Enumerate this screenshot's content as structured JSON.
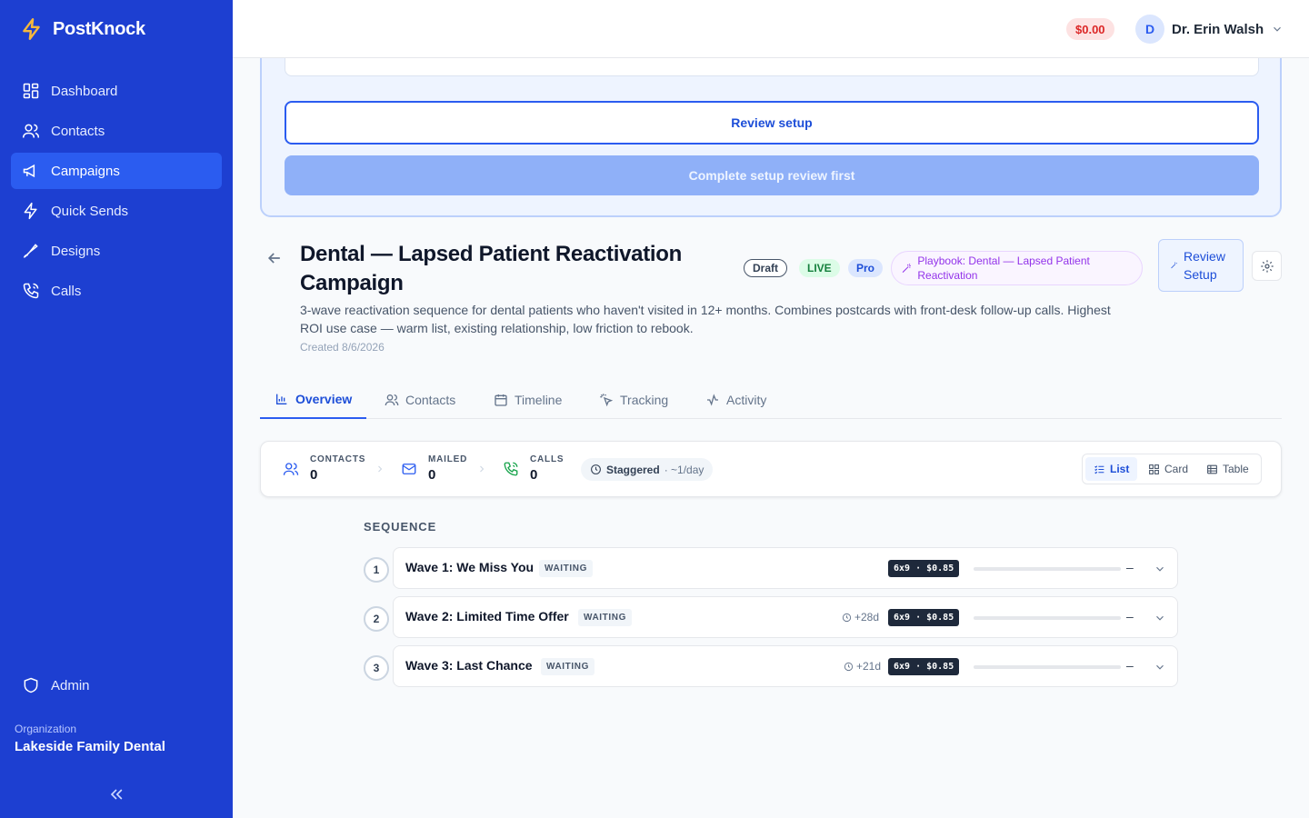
{
  "app": {
    "name": "PostKnock"
  },
  "sidebar": {
    "items": [
      {
        "label": "Dashboard",
        "icon": "grid-icon"
      },
      {
        "label": "Contacts",
        "icon": "users-icon"
      },
      {
        "label": "Campaigns",
        "icon": "megaphone-icon",
        "active": true
      },
      {
        "label": "Quick Sends",
        "icon": "lightning-icon"
      },
      {
        "label": "Designs",
        "icon": "palette-icon"
      },
      {
        "label": "Calls",
        "icon": "phone-icon"
      }
    ],
    "admin_label": "Admin",
    "org_label": "Organization",
    "org_name": "Lakeside Family Dental"
  },
  "header": {
    "balance": "$0.00",
    "user_initial": "D",
    "user_name": "Dr. Erin Walsh"
  },
  "setup": {
    "review_button": "Review setup",
    "complete_button": "Complete setup review first"
  },
  "campaign": {
    "title": "Dental — Lapsed Patient Reactivation Campaign",
    "badges": {
      "draft": "Draft",
      "live": "LIVE",
      "pro": "Pro"
    },
    "playbook": "Playbook: Dental — Lapsed Patient Reactivation",
    "review_button": "Review Setup",
    "description": "3-wave reactivation sequence for dental patients who haven't visited in 12+ months. Combines postcards with front-desk follow-up calls. Highest ROI use case — warm list, existing relationship, low friction to rebook.",
    "created": "Created 8/6/2026"
  },
  "tabs": [
    "Overview",
    "Contacts",
    "Timeline",
    "Tracking",
    "Activity"
  ],
  "stats": {
    "contacts": {
      "label": "CONTACTS",
      "value": "0"
    },
    "mailed": {
      "label": "MAILED",
      "value": "0"
    },
    "calls": {
      "label": "CALLS",
      "value": "0"
    },
    "pacing": "Staggered",
    "pacing_rate": "· ~1/day"
  },
  "views": [
    "List",
    "Card",
    "Table"
  ],
  "sequence": {
    "label": "SEQUENCE",
    "waves": [
      {
        "num": "1",
        "title": "Wave 1: We Miss You",
        "status": "WAITING",
        "delay": "",
        "size": "6x9 · $0.85",
        "progress": 0,
        "count": "–"
      },
      {
        "num": "2",
        "title": "Wave 2: Limited Time Offer",
        "status": "WAITING",
        "delay": "+28d",
        "size": "6x9 · $0.85",
        "progress": 0,
        "count": "–"
      },
      {
        "num": "3",
        "title": "Wave 3: Last Chance",
        "status": "WAITING",
        "delay": "+21d",
        "size": "6x9 · $0.85",
        "progress": 0,
        "count": "–"
      }
    ]
  },
  "colors": {
    "sidebar": "#1d3fd1",
    "accent": "#2b5cf0",
    "brand_bolt": "#f5b83d"
  }
}
